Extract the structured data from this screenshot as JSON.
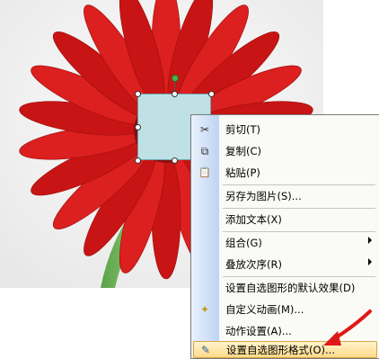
{
  "menu": {
    "items": [
      {
        "label": "剪切(T)",
        "icon": "scissors-icon",
        "glyph": "✂"
      },
      {
        "label": "复制(C)",
        "icon": "copy-icon",
        "glyph": "⧉"
      },
      {
        "label": "粘贴(P)",
        "icon": "paste-icon",
        "glyph": "📋"
      },
      {
        "label": "另存为图片(S)...",
        "icon": "",
        "glyph": ""
      },
      {
        "label": "添加文本(X)",
        "icon": "",
        "glyph": ""
      },
      {
        "label": "组合(G)",
        "icon": "",
        "glyph": "",
        "submenu": true
      },
      {
        "label": "叠放次序(R)",
        "icon": "",
        "glyph": "",
        "submenu": true
      },
      {
        "label": "设置自选图形的默认效果(D)",
        "icon": "",
        "glyph": ""
      },
      {
        "label": "自定义动画(M)...",
        "icon": "animation-icon",
        "glyph": "✦"
      },
      {
        "label": "动作设置(A)...",
        "icon": "",
        "glyph": ""
      },
      {
        "label": "设置自选图形格式(O)...",
        "icon": "format-shape-icon",
        "glyph": "✎",
        "highlighted": true
      }
    ]
  },
  "colors": {
    "shape_fill": "#bfe1e6",
    "highlight": "#ffd98a",
    "annotation_arrow": "#e01818"
  }
}
